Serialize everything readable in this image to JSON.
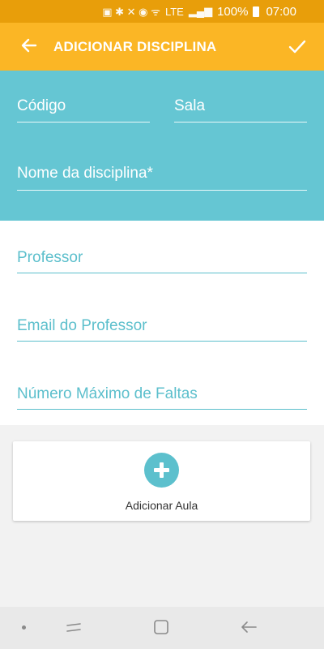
{
  "status_bar": {
    "battery": "100%",
    "time": "07:00",
    "network": "LTE"
  },
  "app_bar": {
    "title": "ADICIONAR DISCIPLINA",
    "back_icon": "arrow-left-icon",
    "confirm_icon": "check-icon"
  },
  "form_header": {
    "codigo_label": "Código",
    "sala_label": "Sala",
    "nome_label": "Nome da disciplina*"
  },
  "form_body": {
    "professor_label": "Professor",
    "email_label": "Email do Professor",
    "faltas_label": "Número Máximo de Faltas"
  },
  "add_class": {
    "label": "Adicionar Aula",
    "icon": "plus-circle-icon"
  },
  "colors": {
    "status_bar": "#e89e0a",
    "app_bar": "#fbb625",
    "header": "#65c6d3",
    "accent": "#5cbfcc"
  }
}
